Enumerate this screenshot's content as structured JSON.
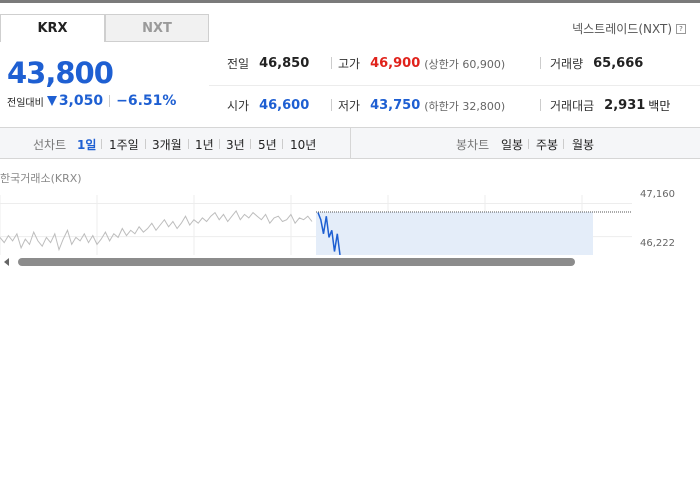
{
  "tabs": [
    {
      "label": "KRX",
      "active": true
    },
    {
      "label": "NXT",
      "active": false
    }
  ],
  "nxt_link": {
    "label": "넥스트레이드(NXT)",
    "help_icon": "help-icon"
  },
  "price": {
    "current": "43,800",
    "change_label": "전일대비",
    "change_icon": "down-triangle-icon",
    "change_value": "3,050",
    "change_pct": "−6.51%",
    "color_down": "#1e5fd2",
    "color_up": "#e0221b"
  },
  "stats": {
    "prev_close": {
      "label": "전일",
      "value": "46,850"
    },
    "high": {
      "label": "고가",
      "value": "46,900",
      "limit_label": "(상한가 60,900)"
    },
    "volume": {
      "label": "거래량",
      "value": "65,666"
    },
    "open": {
      "label": "시가",
      "value": "46,600"
    },
    "low": {
      "label": "저가",
      "value": "43,750",
      "limit_label": "(하한가 32,800)"
    },
    "trade_value": {
      "label": "거래대금",
      "value": "2,931",
      "unit": "백만"
    }
  },
  "period_bar": {
    "line_chart_label": "선차트",
    "line_periods": [
      "1일",
      "1주일",
      "3개월",
      "1년",
      "3년",
      "5년",
      "10년"
    ],
    "active_period": "1일",
    "candle_chart_label": "봉차트",
    "candle_periods": [
      "일봉",
      "주봉",
      "월봉"
    ]
  },
  "chart": {
    "title": "한국거래소(KRX)",
    "y_labels": [
      "47,160",
      "46,222"
    ]
  },
  "chart_data": {
    "type": "line",
    "ylim": [
      45700,
      47400
    ],
    "y_ticks": [
      47160,
      46222
    ],
    "series": [
      {
        "values": [
          46200,
          46050,
          46250,
          46100,
          46300,
          45900,
          46150,
          46000,
          46350,
          46100,
          45950,
          46200,
          46050,
          46300,
          45850,
          46150,
          46400,
          46000,
          46200,
          46100,
          46300,
          46050,
          46250,
          46000,
          46150,
          46350,
          46100,
          46300,
          46200,
          46450,
          46250,
          46400,
          46300,
          46500,
          46350,
          46450,
          46600,
          46400,
          46550,
          46700,
          46500,
          46650,
          46450,
          46600,
          46800,
          46550,
          46700,
          46600,
          46750,
          46650,
          46800,
          46900,
          46700,
          46850,
          46650,
          46800,
          46950,
          46700,
          46850,
          46750,
          46900,
          46800,
          46700,
          46850,
          46600,
          46750,
          46800,
          46650,
          46700,
          46850,
          46600,
          46750,
          46700,
          46800,
          46650
        ]
      },
      {
        "values": [
          46900,
          46700,
          46300,
          46800,
          46200,
          46400,
          45800,
          46300,
          45700
        ]
      }
    ]
  }
}
